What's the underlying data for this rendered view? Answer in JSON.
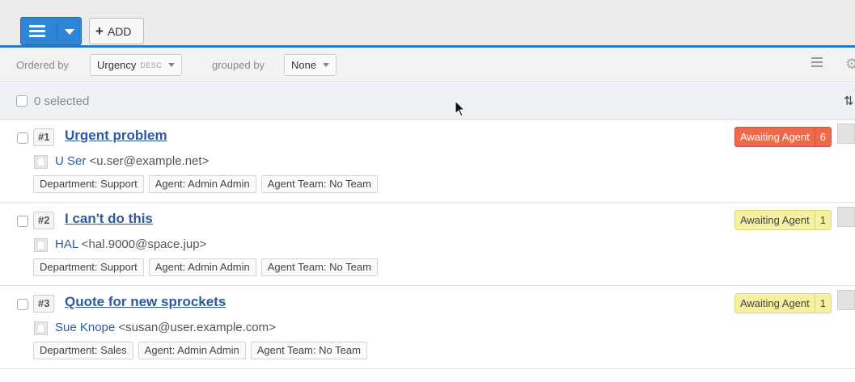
{
  "toolbar": {
    "menu_icon": "hamburger-menu-icon",
    "caret_icon": "caret-down-icon",
    "add_icon": "+",
    "add_label": "ADD"
  },
  "order": {
    "ordered_by_label": "Ordered by",
    "ordered_by_value": "Urgency",
    "direction": "DESC",
    "grouped_by_label": "grouped by",
    "grouped_by_value": "None"
  },
  "selection": {
    "label": "0 selected"
  },
  "tickets": [
    {
      "id": "#1",
      "subject": "Urgent problem",
      "person_name": "U Ser",
      "person_email": "<u.ser@example.net>",
      "tags": [
        "Department: Support",
        "Agent: Admin Admin",
        "Agent Team: No Team"
      ],
      "status_label": "Awaiting Agent",
      "status_count": "6",
      "status_color": "#ee6a4a"
    },
    {
      "id": "#2",
      "subject": "I can't do this",
      "person_name": "HAL",
      "person_email": "<hal.9000@space.jup>",
      "tags": [
        "Department: Support",
        "Agent: Admin Admin",
        "Agent Team: No Team"
      ],
      "status_label": "Awaiting Agent",
      "status_count": "1",
      "status_color": "#f6f1a2"
    },
    {
      "id": "#3",
      "subject": "Quote for new sprockets",
      "person_name": "Sue Knope",
      "person_email": "<susan@user.example.com>",
      "tags": [
        "Department: Sales",
        "Agent: Admin Admin",
        "Agent Team: No Team"
      ],
      "status_label": "Awaiting Agent",
      "status_count": "1",
      "status_color": "#f6f1a2"
    }
  ],
  "colors": {
    "accent": "#2f86d6",
    "link": "#2c5aa0"
  }
}
